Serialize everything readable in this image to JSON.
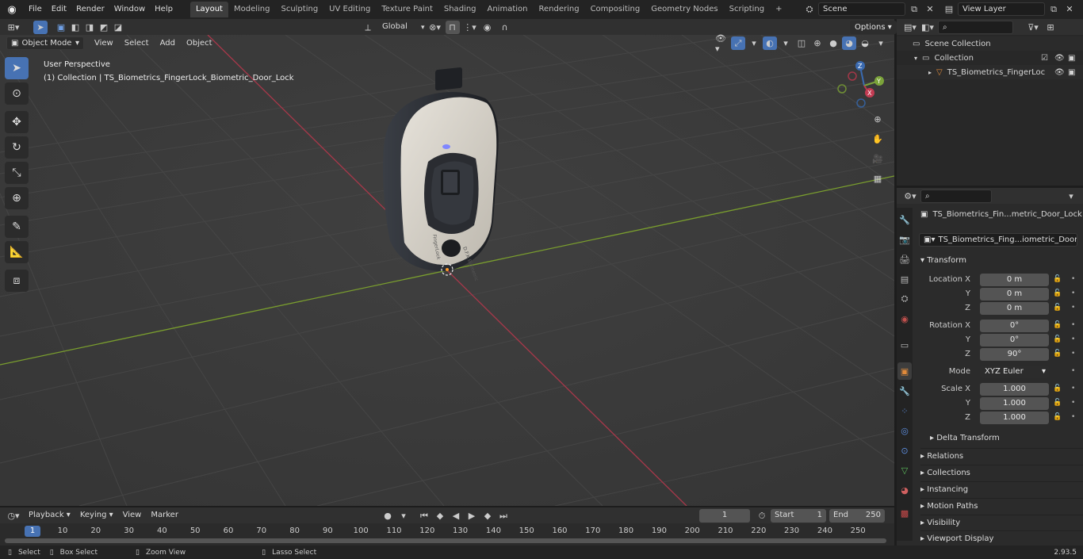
{
  "menus": [
    "File",
    "Edit",
    "Render",
    "Window",
    "Help"
  ],
  "workspaces": [
    "Layout",
    "Modeling",
    "Sculpting",
    "UV Editing",
    "Texture Paint",
    "Shading",
    "Animation",
    "Rendering",
    "Compositing",
    "Geometry Nodes",
    "Scripting"
  ],
  "scene_field": "Scene",
  "view_layer_field": "View Layer",
  "tool_header": {
    "orientation": "Global",
    "options": "Options"
  },
  "viewport_header": {
    "mode": "Object Mode",
    "menus": [
      "View",
      "Select",
      "Add",
      "Object"
    ]
  },
  "overlay": {
    "perspective": "User Perspective",
    "collection_line": "(1) Collection | TS_Biometrics_FingerLock_Biometric_Door_Lock"
  },
  "device_text": {
    "brand": "FingerLock",
    "model": "D.F.K.Biometric"
  },
  "gizmo": {
    "z": "Z",
    "y": "Y",
    "x": "X"
  },
  "outliner": {
    "scene_collection": "Scene Collection",
    "collection": "Collection",
    "object": "TS_Biometrics_FingerLoc"
  },
  "properties": {
    "object_name": "TS_Biometrics_Fin...metric_Door_Lock",
    "data_name": "TS_Biometrics_Fing...iometric_Door_Lock",
    "transform_title": "Transform",
    "location_label": "Location X",
    "rotation_label": "Rotation X",
    "scale_label": "Scale X",
    "y_label": "Y",
    "z_label": "Z",
    "location": [
      "0 m",
      "0 m",
      "0 m"
    ],
    "rotation": [
      "0°",
      "0°",
      "90°"
    ],
    "mode_label": "Mode",
    "mode_value": "XYZ Euler",
    "scale": [
      "1.000",
      "1.000",
      "1.000"
    ],
    "delta_transform": "Delta Transform",
    "panels": [
      "Relations",
      "Collections",
      "Instancing",
      "Motion Paths",
      "Visibility",
      "Viewport Display"
    ]
  },
  "timeline": {
    "menus": [
      "Playback",
      "Keying",
      "View",
      "Marker"
    ],
    "current_frame": "1",
    "start_label": "Start",
    "start_value": "1",
    "end_label": "End",
    "end_value": "250",
    "ticks": [
      "1",
      "10",
      "20",
      "30",
      "40",
      "50",
      "60",
      "70",
      "80",
      "90",
      "100",
      "110",
      "120",
      "130",
      "140",
      "150",
      "160",
      "170",
      "180",
      "190",
      "200",
      "210",
      "220",
      "230",
      "240",
      "250"
    ]
  },
  "statusbar": {
    "select": "Select",
    "box_select": "Box Select",
    "zoom_view": "Zoom View",
    "lasso_select": "Lasso Select",
    "version": "2.93.5"
  },
  "colors": {
    "accent": "#4772b3",
    "x_axis": "#b0384c",
    "y_axis": "#8bb83c",
    "viewport_bg": "#3b3b3b"
  }
}
